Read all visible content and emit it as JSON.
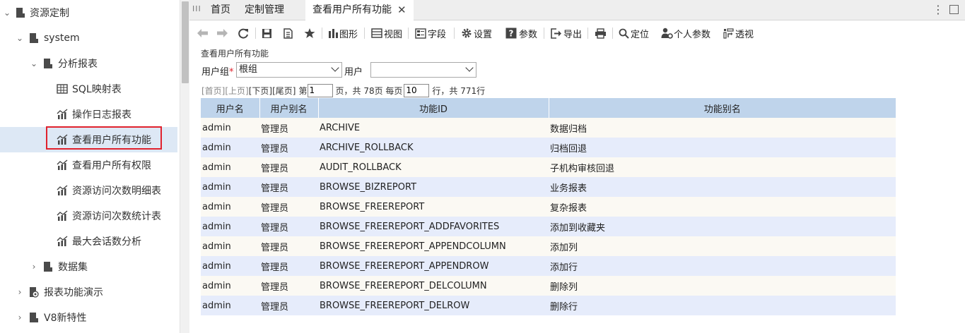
{
  "sidebar": {
    "items": [
      {
        "label": "资源定制",
        "expanded": true,
        "icon": "folder-icon"
      },
      {
        "label": "system",
        "expanded": true,
        "icon": "folder-icon"
      },
      {
        "label": "分析报表",
        "expanded": true,
        "icon": "folder-icon"
      },
      {
        "label": "SQL映射表",
        "icon": "table-icon"
      },
      {
        "label": "操作日志报表",
        "icon": "report-icon"
      },
      {
        "label": "查看用户所有功能",
        "icon": "report-icon",
        "selected": true
      },
      {
        "label": "查看用户所有权限",
        "icon": "report-icon"
      },
      {
        "label": "资源访问次数明细表",
        "icon": "report-icon"
      },
      {
        "label": "资源访问次数统计表",
        "icon": "report-icon"
      },
      {
        "label": "最大会话数分析",
        "icon": "report-icon"
      },
      {
        "label": "数据集",
        "expanded": false,
        "icon": "folder-icon"
      },
      {
        "label": "报表功能演示",
        "expanded": false,
        "icon": "demo-folder-icon"
      },
      {
        "label": "V8新特性",
        "expanded": false,
        "icon": "folder-icon"
      }
    ]
  },
  "tabs": [
    {
      "label": "首页"
    },
    {
      "label": "定制管理"
    },
    {
      "label": "查看用户所有功能",
      "active": true
    }
  ],
  "toolbar": {
    "back": "back-icon",
    "forward": "forward-icon",
    "refresh": "refresh-icon",
    "save": "save-icon",
    "save_as": "save-as-icon",
    "favorite": "star-icon",
    "chart_label": "图形",
    "view_label": "视图",
    "field_label": "字段",
    "settings_label": "设置",
    "params_label": "参数",
    "export_label": "导出",
    "locate_label": "定位",
    "personal_params_label": "个人参数",
    "pivot_label": "透视"
  },
  "report": {
    "title": "查看用户所有功能",
    "group_label": "用户组",
    "group_required": "*",
    "group_value": "根组",
    "user_label": "用户",
    "user_value": "",
    "pager": {
      "first": "[首页]",
      "prev": "[上页]",
      "next": "[下页]",
      "last": "[尾页]",
      "page_prefix": "第",
      "current_page": "1",
      "total_pages_text": "页，共 78页 每页",
      "page_size": "10",
      "total_rows_text": "行，共 771行"
    },
    "columns": [
      "用户名",
      "用户别名",
      "功能ID",
      "功能别名"
    ],
    "rows": [
      [
        "admin",
        "管理员",
        "ARCHIVE",
        "数据归档"
      ],
      [
        "admin",
        "管理员",
        "ARCHIVE_ROLLBACK",
        "归档回退"
      ],
      [
        "admin",
        "管理员",
        "AUDIT_ROLLBACK",
        "子机构审核回退"
      ],
      [
        "admin",
        "管理员",
        "BROWSE_BIZREPORT",
        "业务报表"
      ],
      [
        "admin",
        "管理员",
        "BROWSE_FREEREPORT",
        "复杂报表"
      ],
      [
        "admin",
        "管理员",
        "BROWSE_FREEREPORT_ADDFAVORITES",
        "添加到收藏夹"
      ],
      [
        "admin",
        "管理员",
        "BROWSE_FREEREPORT_APPENDCOLUMN",
        "添加列"
      ],
      [
        "admin",
        "管理员",
        "BROWSE_FREEREPORT_APPENDROW",
        "添加行"
      ],
      [
        "admin",
        "管理员",
        "BROWSE_FREEREPORT_DELCOLUMN",
        "删除列"
      ],
      [
        "admin",
        "管理员",
        "BROWSE_FREEREPORT_DELROW",
        "删除行"
      ]
    ]
  },
  "colors": {
    "header_bg": "#bfd4eb",
    "row_odd": "#fbf9f3",
    "row_even": "#e6ecfb",
    "selected_tree": "#dde8f5",
    "highlight_border": "#e0222d"
  }
}
